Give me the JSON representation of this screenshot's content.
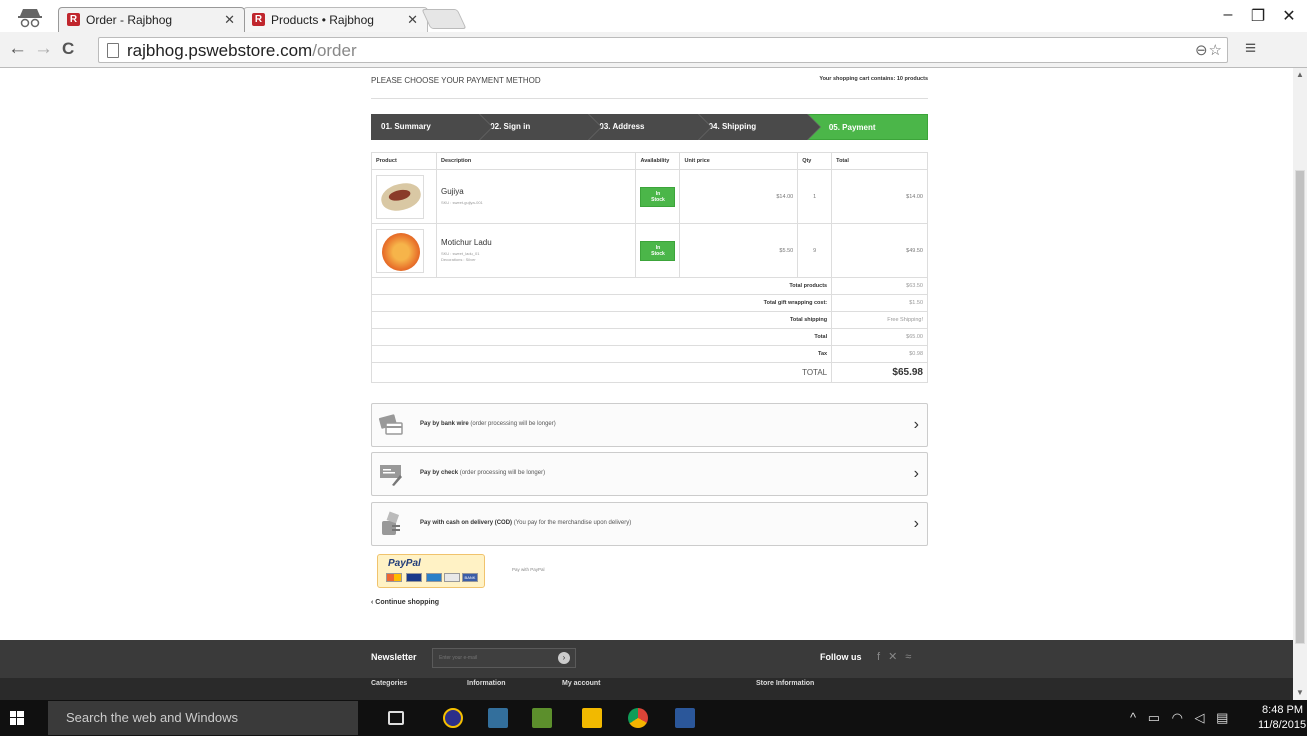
{
  "browser": {
    "tabs": [
      {
        "title": "Order - Rajbhog",
        "active": true
      },
      {
        "title": "Products • Rajbhog",
        "active": false
      }
    ],
    "url_host": "rajbhog.pswebstore.com",
    "url_path": "/order",
    "window_controls": {
      "minimize": "–",
      "restore": "❐",
      "close": "✕"
    }
  },
  "page": {
    "heading": "PLEASE CHOOSE YOUR PAYMENT METHOD",
    "cart_info": "Your shopping cart contains: 10 products",
    "steps": [
      "01. Summary",
      "02. Sign in",
      "03. Address",
      "04. Shipping",
      "05. Payment"
    ],
    "current_step": 4,
    "table": {
      "headers": [
        "Product",
        "Description",
        "Availability",
        "Unit price",
        "Qty",
        "Total"
      ],
      "rows": [
        {
          "name": "Gujiya",
          "sku": "SKU : sweet-gujiya-001",
          "attr": "",
          "availability": "In Stock",
          "unit_price": "$14.00",
          "qty": "1",
          "total": "$14.00"
        },
        {
          "name": "Motichur Ladu",
          "sku": "SKU : sweet_ladu_01",
          "attr": "Decorations : Silver",
          "availability": "In Stock",
          "unit_price": "$5.50",
          "qty": "9",
          "total": "$49.50"
        }
      ],
      "summary": [
        {
          "label": "Total products",
          "value": "$63.50"
        },
        {
          "label": "Total gift wrapping cost:",
          "value": "$1.50"
        },
        {
          "label": "Total shipping",
          "value": "Free Shipping!"
        },
        {
          "label": "Total",
          "value": "$65.00"
        },
        {
          "label": "Tax",
          "value": "$0.98"
        }
      ],
      "grand_total": {
        "label": "TOTAL",
        "value": "$65.98"
      }
    },
    "payment_options": [
      {
        "title": "Pay by bank wire",
        "note": "(order processing will be longer)"
      },
      {
        "title": "Pay by check",
        "note": "(order processing will be longer)"
      },
      {
        "title": "Pay with cash on delivery (COD)",
        "note": "(You pay for the merchandise upon delivery)"
      }
    ],
    "paypal": {
      "logo": "PayPal",
      "label": "Pay with PayPal",
      "card_bank": "BANK"
    },
    "continue": "Continue shopping"
  },
  "footer": {
    "newsletter_label": "Newsletter",
    "newsletter_placeholder": "Enter your e-mail",
    "follow_label": "Follow us",
    "columns": [
      "Categories",
      "Information",
      "My account",
      "Store Information"
    ]
  },
  "taskbar": {
    "search_placeholder": "Search the web and Windows",
    "time": "8:48 PM",
    "date": "11/8/2015"
  },
  "colors": {
    "accent_green": "#4bb649",
    "step_dark": "#4a4a4a",
    "footer_dark": "#3a3a3a"
  }
}
